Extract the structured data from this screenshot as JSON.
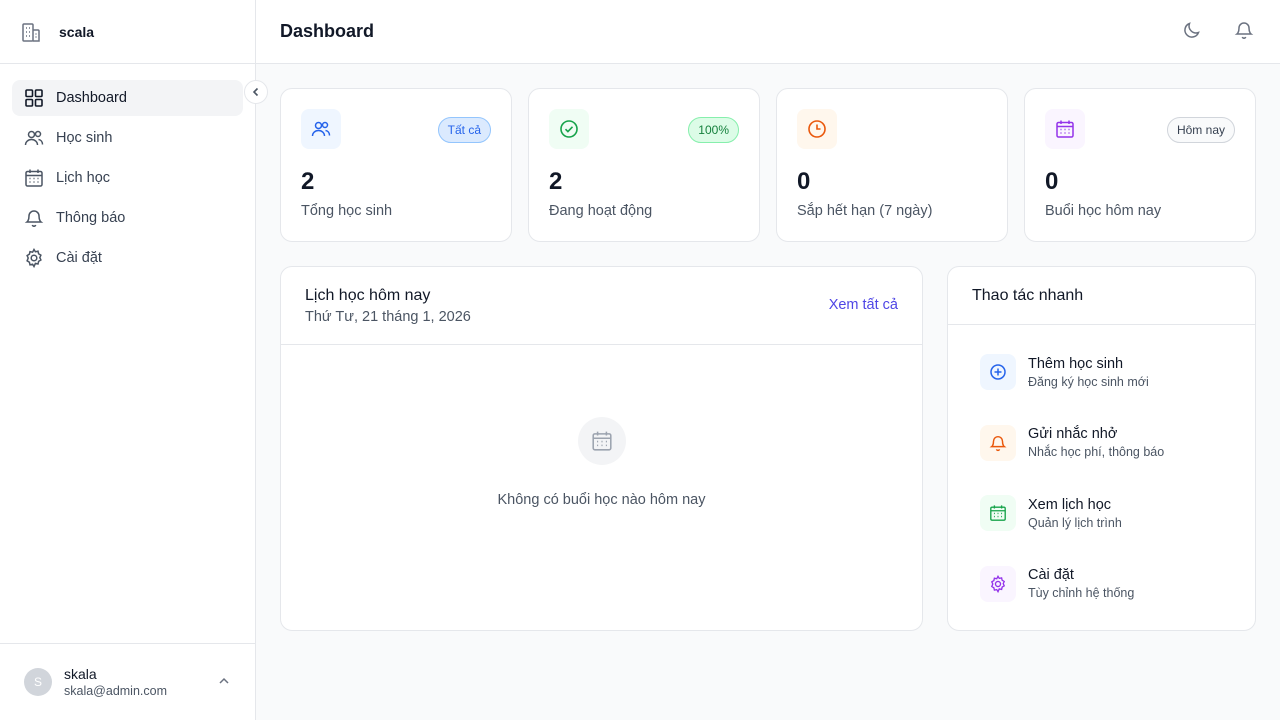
{
  "app": {
    "brand": "scala",
    "page_title": "Dashboard"
  },
  "sidebar": {
    "items": [
      {
        "label": "Dashboard",
        "icon": "grid-icon",
        "active": true
      },
      {
        "label": "Học sinh",
        "icon": "users-icon"
      },
      {
        "label": "Lịch học",
        "icon": "calendar-icon"
      },
      {
        "label": "Thông báo",
        "icon": "bell-icon"
      },
      {
        "label": "Cài đặt",
        "icon": "gear-icon"
      }
    ]
  },
  "user": {
    "initial": "S",
    "name": "skala",
    "email": "skala@admin.com"
  },
  "header": {
    "actions": [
      "moon-icon",
      "bell-icon"
    ]
  },
  "stats": [
    {
      "value": "2",
      "label": "Tổng học sinh",
      "badge": "Tất cả",
      "icon": "users-icon",
      "color": "#2563eb",
      "bg": "#eff6ff",
      "badge_bg": "#dbeafe",
      "badge_border": "#93c5fd",
      "badge_color": "#2563eb"
    },
    {
      "value": "2",
      "label": "Đang hoạt động",
      "badge": "100%",
      "icon": "check-circle-icon",
      "color": "#16a34a",
      "bg": "#f0fdf4",
      "badge_bg": "#dcfce7",
      "badge_border": "#86efac",
      "badge_color": "#15803d"
    },
    {
      "value": "0",
      "label": "Sắp hết hạn (7 ngày)",
      "badge": "",
      "icon": "clock-icon",
      "color": "#ea580c",
      "bg": "#fff7ed"
    },
    {
      "value": "0",
      "label": "Buổi học hôm nay",
      "badge": "Hôm nay",
      "icon": "calendar-icon",
      "color": "#9333ea",
      "bg": "#faf5ff",
      "badge_bg": "#f9fafb",
      "badge_border": "#d1d5db",
      "badge_color": "#374151"
    }
  ],
  "schedule": {
    "title": "Lịch học hôm nay",
    "date": "Thứ Tư, 21 tháng 1, 2026",
    "view_all": "Xem tất cả",
    "empty_text": "Không có buổi học nào hôm nay"
  },
  "quick": {
    "title": "Thao tác nhanh",
    "items": [
      {
        "title": "Thêm học sinh",
        "desc": "Đăng ký học sinh mới",
        "icon": "plus-circle-icon",
        "color": "#2563eb",
        "bg": "#eff6ff"
      },
      {
        "title": "Gửi nhắc nhở",
        "desc": "Nhắc học phí, thông báo",
        "icon": "bell-icon",
        "color": "#ea580c",
        "bg": "#fff7ed"
      },
      {
        "title": "Xem lịch học",
        "desc": "Quản lý lịch trình",
        "icon": "calendar-icon",
        "color": "#16a34a",
        "bg": "#f0fdf4"
      },
      {
        "title": "Cài đặt",
        "desc": "Tùy chỉnh hệ thống",
        "icon": "gear-icon",
        "color": "#9333ea",
        "bg": "#faf5ff"
      }
    ]
  }
}
